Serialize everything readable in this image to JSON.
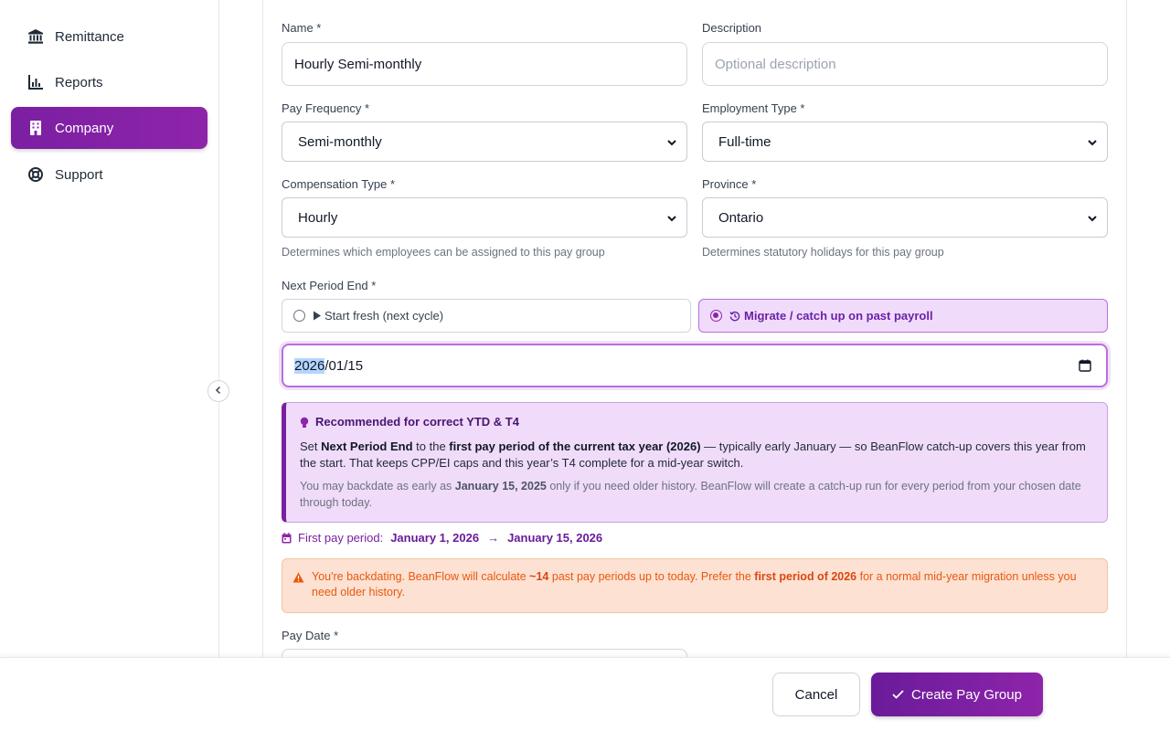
{
  "sidebar": {
    "items": [
      {
        "label": "Remittance",
        "icon": "bank-icon"
      },
      {
        "label": "Reports",
        "icon": "bar-chart-icon"
      },
      {
        "label": "Company",
        "icon": "building-icon",
        "active": true
      },
      {
        "label": "Support",
        "icon": "lifebuoy-icon"
      }
    ]
  },
  "form": {
    "name_label": "Name *",
    "name_value": "Hourly Semi-monthly",
    "description_label": "Description",
    "description_placeholder": "Optional description",
    "pay_frequency_label": "Pay Frequency *",
    "pay_frequency_value": "Semi-monthly",
    "employment_type_label": "Employment Type *",
    "employment_type_value": "Full-time",
    "compensation_type_label": "Compensation Type *",
    "compensation_type_value": "Hourly",
    "compensation_helper": "Determines which employees can be assigned to this pay group",
    "province_label": "Province *",
    "province_value": "Ontario",
    "province_helper": "Determines statutory holidays for this pay group",
    "next_period_label": "Next Period End *",
    "option_fresh": "Start fresh (next cycle)",
    "option_migrate": "Migrate / catch up on past payroll",
    "date_year": "2026",
    "date_rest": "/01/15",
    "pay_date_label": "Pay Date *"
  },
  "tip": {
    "title": "Recommended for correct YTD & T4",
    "p1_a": "Set ",
    "p1_b": "Next Period End",
    "p1_c": " to the ",
    "p1_d": "first pay period of the current tax year (2026)",
    "p1_e": " — typically early January — so BeanFlow catch-up covers this year from the start. That keeps CPP/EI caps and this year’s T4 complete for a mid-year switch.",
    "p2_a": "You may backdate as early as ",
    "p2_b": "January 15, 2025",
    "p2_c": " only if you need older history. BeanFlow will create a catch-up run for every period from your chosen date through today."
  },
  "period": {
    "label": "First pay period:",
    "start": "January 1, 2026",
    "arrow": "→",
    "end": "January 15, 2026"
  },
  "warning": {
    "a": "You're backdating. BeanFlow will calculate ",
    "b": "~14",
    "c": " past pay periods up to today. Prefer the ",
    "d": "first period of 2026",
    "e": " for a normal mid-year migration unless you need older history."
  },
  "footer": {
    "cancel": "Cancel",
    "create": "Create Pay Group"
  },
  "colors": {
    "accent": "#8e24aa",
    "warning": "#e8590c"
  }
}
